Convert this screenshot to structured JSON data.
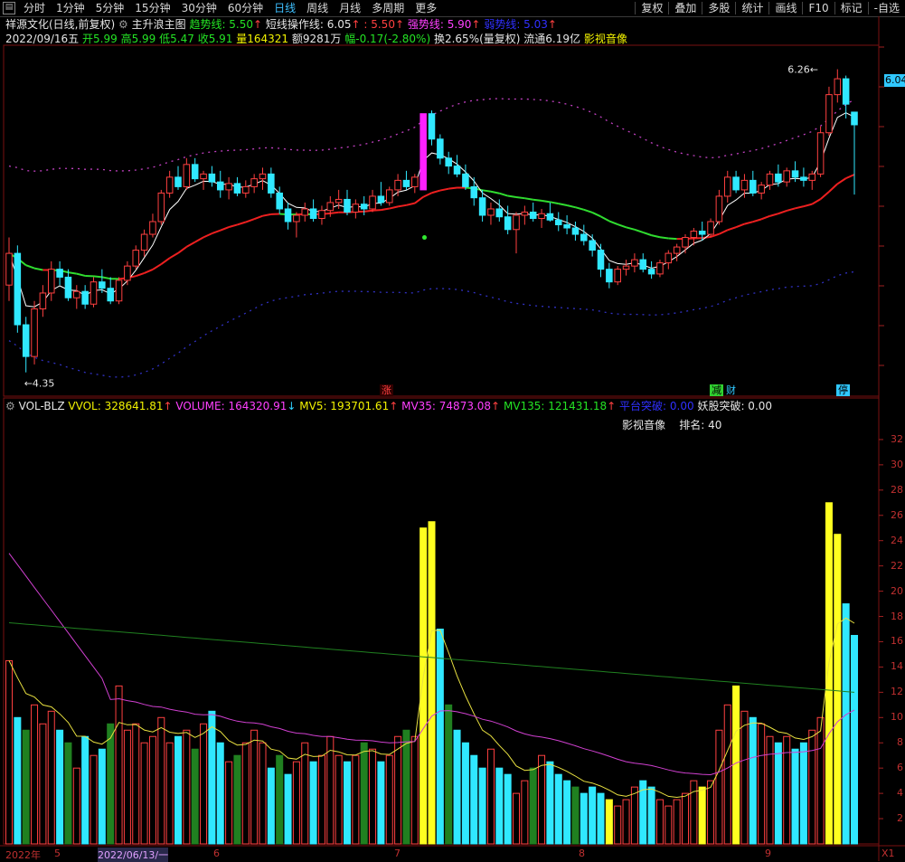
{
  "toolbar": {
    "left_items": [
      "分时",
      "1分钟",
      "5分钟",
      "15分钟",
      "30分钟",
      "60分钟",
      "日线",
      "周线",
      "月线",
      "多周期",
      "更多"
    ],
    "active_item": "日线",
    "right_items": [
      "复权",
      "叠加",
      "多股",
      "统计",
      "画线",
      "F10",
      "标记",
      "-自选"
    ]
  },
  "header": {
    "stock_name": "祥源文化(日线,前复权)",
    "indicator_name": "主升浪主图",
    "trend_label": "趋势线: 5.50",
    "short_label": "短线操作线: 6.05",
    "short_value2": ": 5.50",
    "strong_label": "强势线: 5.90",
    "weak_label": "弱势线: 5.03"
  },
  "quote": {
    "date": "2022/09/16五",
    "open": "开5.99",
    "high": "高5.99",
    "low": "低5.47",
    "close": "收5.91",
    "volume": "量164321",
    "amount": "额9281万",
    "change": "幅-0.17(-2.80%)",
    "turnover": "换2.65%(量复权)",
    "float_cap": "流通6.19亿",
    "concept": "影视音像"
  },
  "main_chart": {
    "price_max_label": "6.26",
    "price_min_label": "4.35",
    "current_price_tag": "6.04",
    "markers": [
      "涨",
      "减",
      "财",
      "停"
    ]
  },
  "volume_panel": {
    "name": "VOL-BLZ",
    "vvol": "VVOL: 328641.81",
    "volume": "VOLUME: 164320.91",
    "mv5": "MV5: 193701.61",
    "mv35": "MV35: 74873.08",
    "mv135": "MV135: 121431.18",
    "platform": "平台突破: 0.00",
    "demon": "妖股突破: 0.00",
    "sector": "影视音像",
    "rank": "排名: 40",
    "y_axis": [
      "32",
      "30",
      "28",
      "26",
      "24",
      "22",
      "20",
      "18",
      "16",
      "14",
      "12",
      "10",
      "8",
      "6",
      "4",
      "2"
    ]
  },
  "bottom_axis": {
    "labels": [
      "2022年",
      "5",
      "2022/06/13/一",
      "6",
      "7",
      "8",
      "9",
      "X1"
    ]
  },
  "colors": {
    "up": "#ff4040",
    "down": "#30e8ff",
    "trend_green": "#30dd30",
    "trend_red": "#ee2020",
    "band_magenta": "#c040c0",
    "band_blue": "#3030c0",
    "vol_yellow": "#ffff20",
    "ma_magenta": "#d040d0",
    "ma_green": "#208020",
    "ma_yellow": "#e8e040"
  },
  "chart_data": {
    "type": "candlestick",
    "price_axis_range": [
      4.2,
      6.4
    ],
    "candles": [
      [
        4.9,
        5.2,
        4.8,
        5.1
      ],
      [
        5.1,
        5.15,
        4.6,
        4.65
      ],
      [
        4.65,
        4.7,
        4.35,
        4.45
      ],
      [
        4.45,
        4.8,
        4.4,
        4.75
      ],
      [
        4.75,
        4.9,
        4.7,
        4.85
      ],
      [
        4.85,
        5.05,
        4.8,
        5.0
      ],
      [
        5.0,
        5.05,
        4.9,
        4.95
      ],
      [
        4.95,
        5.0,
        4.8,
        4.82
      ],
      [
        4.82,
        4.9,
        4.75,
        4.86
      ],
      [
        4.86,
        4.9,
        4.75,
        4.78
      ],
      [
        4.78,
        4.95,
        4.76,
        4.92
      ],
      [
        4.92,
        5.0,
        4.85,
        4.88
      ],
      [
        4.88,
        4.95,
        4.78,
        4.8
      ],
      [
        4.8,
        4.95,
        4.78,
        4.93
      ],
      [
        4.93,
        5.05,
        4.9,
        5.02
      ],
      [
        5.02,
        5.15,
        5.0,
        5.12
      ],
      [
        5.12,
        5.25,
        5.08,
        5.22
      ],
      [
        5.22,
        5.35,
        5.2,
        5.3
      ],
      [
        5.3,
        5.5,
        5.28,
        5.48
      ],
      [
        5.48,
        5.62,
        5.45,
        5.58
      ],
      [
        5.58,
        5.65,
        5.5,
        5.52
      ],
      [
        5.52,
        5.7,
        5.5,
        5.66
      ],
      [
        5.66,
        5.7,
        5.55,
        5.57
      ],
      [
        5.57,
        5.62,
        5.5,
        5.6
      ],
      [
        5.6,
        5.65,
        5.52,
        5.55
      ],
      [
        5.55,
        5.62,
        5.45,
        5.5
      ],
      [
        5.5,
        5.58,
        5.44,
        5.54
      ],
      [
        5.54,
        5.58,
        5.46,
        5.48
      ],
      [
        5.48,
        5.56,
        5.45,
        5.52
      ],
      [
        5.52,
        5.6,
        5.48,
        5.57
      ],
      [
        5.57,
        5.64,
        5.5,
        5.6
      ],
      [
        5.6,
        5.64,
        5.45,
        5.48
      ],
      [
        5.48,
        5.52,
        5.35,
        5.38
      ],
      [
        5.38,
        5.42,
        5.25,
        5.3
      ],
      [
        5.3,
        5.36,
        5.2,
        5.34
      ],
      [
        5.34,
        5.42,
        5.3,
        5.38
      ],
      [
        5.38,
        5.44,
        5.3,
        5.32
      ],
      [
        5.32,
        5.4,
        5.28,
        5.37
      ],
      [
        5.37,
        5.46,
        5.33,
        5.42
      ],
      [
        5.42,
        5.5,
        5.38,
        5.44
      ],
      [
        5.44,
        5.5,
        5.34,
        5.36
      ],
      [
        5.36,
        5.44,
        5.32,
        5.41
      ],
      [
        5.41,
        5.46,
        5.34,
        5.38
      ],
      [
        5.38,
        5.5,
        5.36,
        5.46
      ],
      [
        5.46,
        5.55,
        5.4,
        5.42
      ],
      [
        5.42,
        5.52,
        5.4,
        5.5
      ],
      [
        5.5,
        5.6,
        5.46,
        5.56
      ],
      [
        5.56,
        5.62,
        5.5,
        5.52
      ],
      [
        5.52,
        5.6,
        5.48,
        5.58
      ],
      [
        5.5,
        5.98,
        5.5,
        5.98
      ],
      [
        5.98,
        6.0,
        5.78,
        5.82
      ],
      [
        5.82,
        5.85,
        5.66,
        5.7
      ],
      [
        5.7,
        5.74,
        5.6,
        5.65
      ],
      [
        5.65,
        5.72,
        5.58,
        5.6
      ],
      [
        5.6,
        5.66,
        5.5,
        5.52
      ],
      [
        5.52,
        5.58,
        5.4,
        5.45
      ],
      [
        5.45,
        5.5,
        5.3,
        5.34
      ],
      [
        5.34,
        5.42,
        5.28,
        5.38
      ],
      [
        5.38,
        5.44,
        5.3,
        5.33
      ],
      [
        5.33,
        5.4,
        5.22,
        5.25
      ],
      [
        5.25,
        5.36,
        5.1,
        5.34
      ],
      [
        5.34,
        5.4,
        5.28,
        5.36
      ],
      [
        5.36,
        5.42,
        5.3,
        5.32
      ],
      [
        5.32,
        5.38,
        5.26,
        5.35
      ],
      [
        5.35,
        5.42,
        5.3,
        5.31
      ],
      [
        5.31,
        5.36,
        5.24,
        5.28
      ],
      [
        5.28,
        5.34,
        5.22,
        5.26
      ],
      [
        5.26,
        5.3,
        5.18,
        5.22
      ],
      [
        5.22,
        5.28,
        5.15,
        5.18
      ],
      [
        5.18,
        5.22,
        5.08,
        5.12
      ],
      [
        5.12,
        5.16,
        4.95,
        5.0
      ],
      [
        5.0,
        5.04,
        4.88,
        4.92
      ],
      [
        4.92,
        5.02,
        4.9,
        5.0
      ],
      [
        5.0,
        5.06,
        4.96,
        5.02
      ],
      [
        5.02,
        5.1,
        4.98,
        5.06
      ],
      [
        5.06,
        5.1,
        4.98,
        5.0
      ],
      [
        5.0,
        5.05,
        4.94,
        4.97
      ],
      [
        4.97,
        5.06,
        4.95,
        5.04
      ],
      [
        5.04,
        5.12,
        5.0,
        5.1
      ],
      [
        5.1,
        5.16,
        5.05,
        5.14
      ],
      [
        5.14,
        5.22,
        5.1,
        5.2
      ],
      [
        5.2,
        5.26,
        5.15,
        5.24
      ],
      [
        5.24,
        5.3,
        5.18,
        5.22
      ],
      [
        5.22,
        5.32,
        5.2,
        5.3
      ],
      [
        5.3,
        5.5,
        5.28,
        5.46
      ],
      [
        5.46,
        5.62,
        5.42,
        5.58
      ],
      [
        5.58,
        5.62,
        5.48,
        5.5
      ],
      [
        5.5,
        5.6,
        5.45,
        5.56
      ],
      [
        5.56,
        5.62,
        5.46,
        5.48
      ],
      [
        5.48,
        5.55,
        5.44,
        5.53
      ],
      [
        5.53,
        5.62,
        5.5,
        5.6
      ],
      [
        5.6,
        5.66,
        5.52,
        5.55
      ],
      [
        5.55,
        5.64,
        5.52,
        5.62
      ],
      [
        5.62,
        5.68,
        5.55,
        5.58
      ],
      [
        5.58,
        5.64,
        5.52,
        5.56
      ],
      [
        5.56,
        5.62,
        5.5,
        5.6
      ],
      [
        5.6,
        5.9,
        5.58,
        5.86
      ],
      [
        5.86,
        6.15,
        5.84,
        6.1
      ],
      [
        6.1,
        6.26,
        6.05,
        6.2
      ],
      [
        6.2,
        6.22,
        5.95,
        6.04
      ],
      [
        5.99,
        5.99,
        5.47,
        5.91
      ]
    ],
    "volume_axis_range": [
      0,
      34
    ],
    "volumes": [
      14.5,
      10,
      9,
      11,
      9.5,
      10.5,
      9,
      8,
      6,
      8.5,
      7,
      7.5,
      9.5,
      12.5,
      9,
      9.5,
      8,
      8.5,
      10,
      8,
      8.5,
      9,
      7.5,
      9.5,
      10.5,
      8,
      6.5,
      7,
      8,
      9,
      8,
      6,
      7,
      5.5,
      6.5,
      8,
      6.5,
      7,
      8.5,
      7,
      6.5,
      7,
      8,
      7.5,
      6.5,
      7,
      8.5,
      9,
      8.5,
      25,
      25.5,
      17,
      11,
      9,
      8,
      7,
      6,
      7.5,
      6,
      5.5,
      4,
      5,
      6,
      7,
      6.5,
      5.5,
      5,
      4.5,
      4,
      4.5,
      4,
      3.5,
      3,
      3.5,
      4.5,
      5,
      4.5,
      3.5,
      3,
      3.5,
      4,
      5,
      4.5,
      5,
      9,
      11,
      12.5,
      10.5,
      10,
      9.5,
      8.5,
      8,
      8.5,
      7.5,
      8,
      9,
      10,
      27,
      24.5,
      19,
      16.5
    ]
  }
}
